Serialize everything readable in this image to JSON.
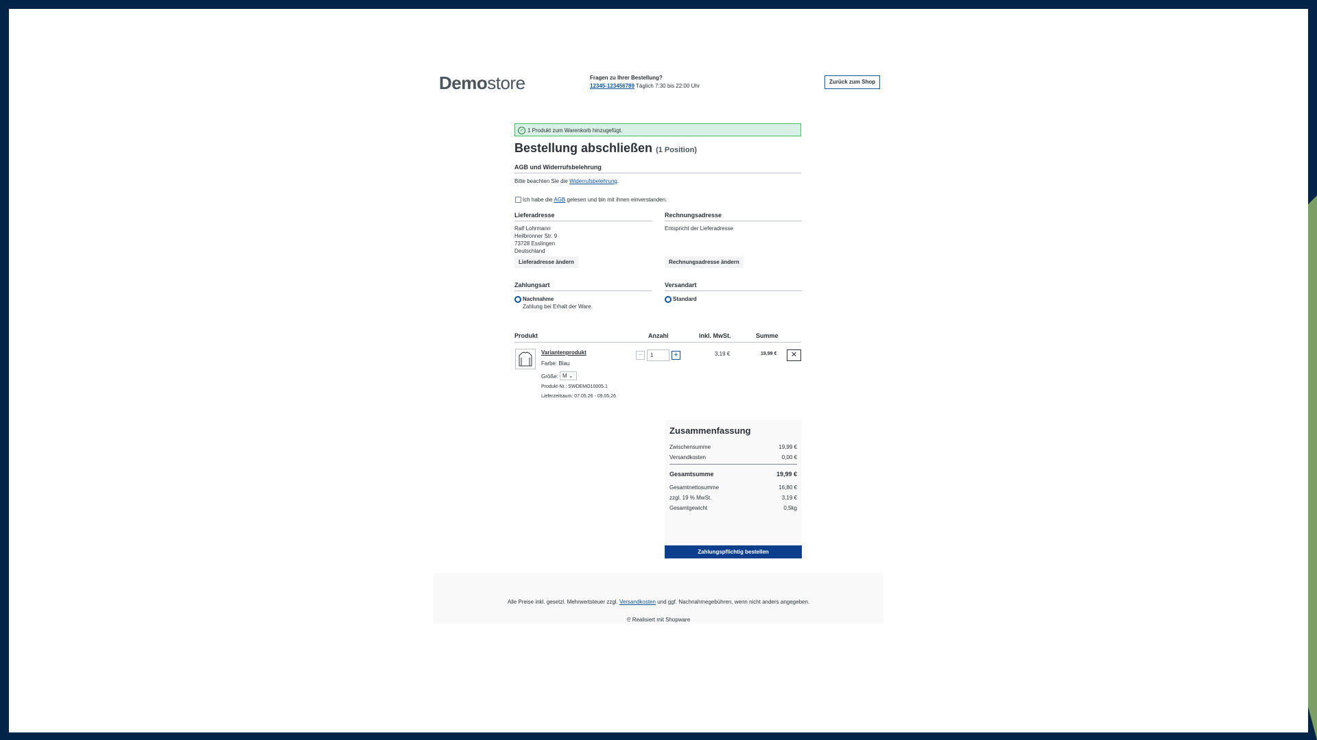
{
  "header": {
    "logo_bold": "Demo",
    "logo_light": "store",
    "help_question": "Fragen zu Ihrer Bestellung?",
    "help_phone": "12345-123456789",
    "help_hours": " Täglich 7:30 bis 22:00 Uhr",
    "back_button": "Zurück zum Shop"
  },
  "alert": {
    "message": "1 Produkt zum Warenkorb hinzugefügt."
  },
  "page": {
    "title": "Bestellung abschließen",
    "positions": "(1 Position)"
  },
  "terms": {
    "heading": "AGB und Widerrufsbelehrung",
    "notice_prefix": "Bitte beachten Sie die ",
    "notice_link": "Widerrufsbelehrung",
    "notice_suffix": ".",
    "checkbox_prefix": "Ich habe die ",
    "checkbox_link": "AGB",
    "checkbox_suffix": " gelesen und bin mit ihnen einverstanden."
  },
  "shipping_address": {
    "heading": "Lieferadresse",
    "lines": [
      "Ralf Lohrmann",
      "Heilbronner Str. 9",
      "73728 Esslingen",
      "Deutschland"
    ],
    "change_button": "Lieferadresse ändern"
  },
  "billing_address": {
    "heading": "Rechnungsadresse",
    "text": "Entspricht der Lieferadresse",
    "change_button": "Rechnungsadresse ändern"
  },
  "payment": {
    "heading": "Zahlungsart",
    "method": "Nachnahme",
    "description": "Zahlung bei Erhalt der Ware."
  },
  "shipping_method": {
    "heading": "Versandart",
    "method": "Standard"
  },
  "cart": {
    "headers": {
      "product": "Produkt",
      "quantity": "Anzahl",
      "tax": "inkl. MwSt.",
      "total": "Summe"
    },
    "item": {
      "name": "Variantenprodukt",
      "color_label": "Farbe: ",
      "color_value": "Blau",
      "size_label": "Größe:",
      "size_value": "M",
      "sku": "Produkt-Nr.: SWDEMO10005.1",
      "delivery": "Lieferzeitraum: 07.05.26 - 09.05.26",
      "quantity": "1",
      "tax": "3,19 €",
      "total": "19,99 €"
    }
  },
  "summary": {
    "heading": "Zusammenfassung",
    "subtotal_label": "Zwischensumme",
    "subtotal_value": "19,99 €",
    "shipping_label": "Versandkosten",
    "shipping_value": "0,00 €",
    "grand_label": "Gesamtsumme",
    "grand_value": "19,99 €",
    "net_label": "Gesamtnettosumme",
    "net_value": "16,80 €",
    "vat_label": "zzgl. 19 % MwSt.",
    "vat_value": "3,19 €",
    "weight_label": "Gesamtgewicht",
    "weight_value": "0,5kg"
  },
  "order_button": "Zahlungspflichtig bestellen",
  "footer": {
    "prefix": "Alle Preise inkl. gesetzl. Mehrwertsteuer zzgl. ",
    "link": "Versandkosten",
    "suffix": " und ggf. Nachnahmegebühren, wenn nicht anders angegeben.",
    "powered": "Realisiert mit Shopware"
  },
  "colors": {
    "primary": "#0b539b",
    "success_bg": "#d8f0e5",
    "success_border": "#3cc261",
    "frame": "#022448",
    "accent_green": "#7aa065"
  }
}
